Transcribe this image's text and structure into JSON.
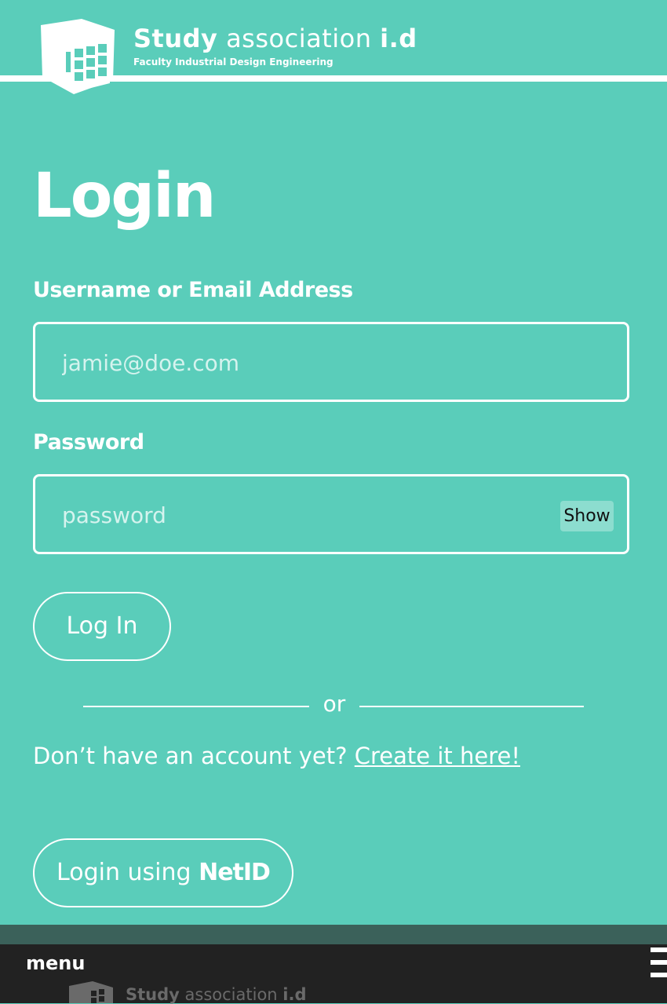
{
  "header": {
    "brand_bold": "Study",
    "brand_light": "association",
    "brand_suffix": "i.d",
    "tagline": "Faculty Industrial Design Engineering"
  },
  "page": {
    "title": "Login"
  },
  "form": {
    "username_label": "Username or Email Address",
    "username_placeholder": "jamie@doe.com",
    "password_label": "Password",
    "password_placeholder": "password",
    "show_label": "Show",
    "submit_label": "Log In"
  },
  "divider": {
    "text": "or"
  },
  "signup": {
    "prompt": "Don’t have an account yet? ",
    "link_label": "Create it here!"
  },
  "netid": {
    "prefix": "Login using ",
    "brand": "NetID"
  },
  "footer": {
    "menu_label": "menu",
    "brand_bold": "Study",
    "brand_light": "association",
    "brand_suffix": "i.d"
  },
  "colors": {
    "background": "#5acdba",
    "footer": "#222222",
    "footer_strip": "#3b615a",
    "text": "#ffffff"
  }
}
